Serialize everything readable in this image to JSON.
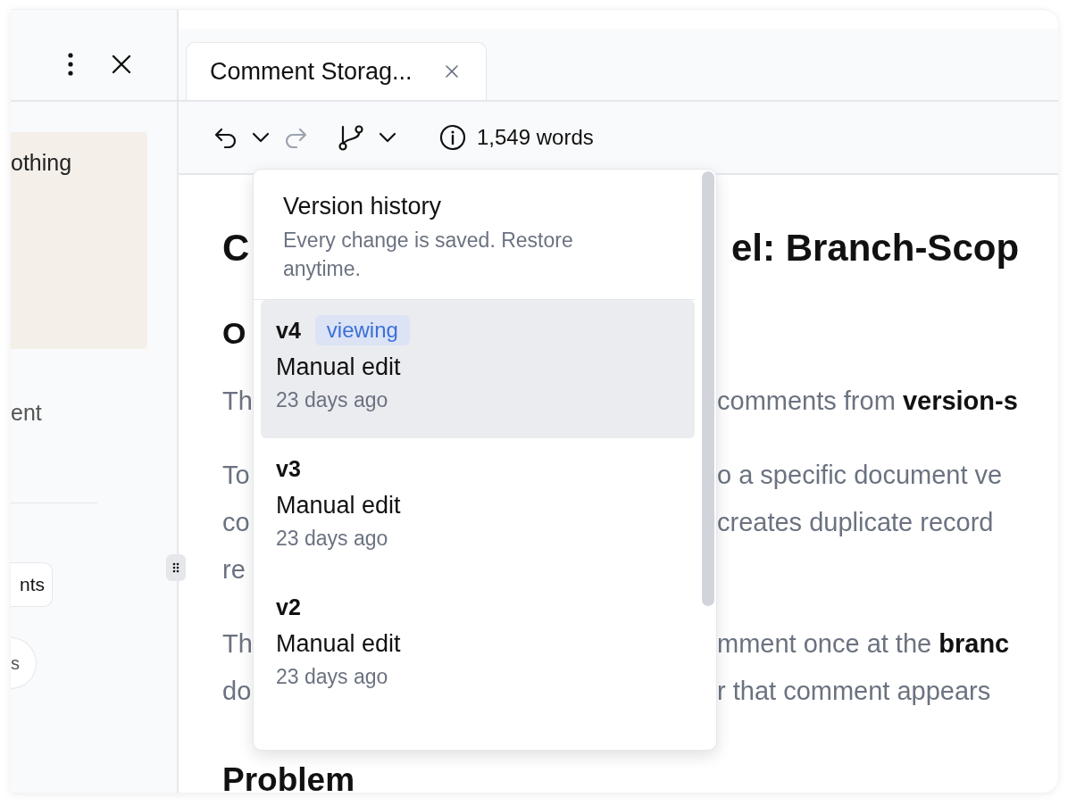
{
  "sidebar": {
    "card_text": "othing",
    "text": "ent",
    "buttons": [
      {
        "kind": "pill",
        "label": "nts"
      },
      {
        "kind": "round",
        "label": "s"
      }
    ]
  },
  "tabs": [
    {
      "label": "Comment Storag...",
      "selected": true
    }
  ],
  "toolbar": {
    "redo_disabled": true,
    "word_count": "1,549 words"
  },
  "document": {
    "title": {
      "left": "C",
      "right": "el: Branch-Scop"
    },
    "heading": "O",
    "paragraphs": [
      [
        {
          "left": "Th",
          "right": "comments from **version-s**"
        }
      ],
      [
        {
          "left": "To",
          "right": "o a specific document ve"
        },
        {
          "left": "co",
          "right": "creates duplicate record"
        },
        {
          "left": "re"
        }
      ],
      [
        {
          "left": "Th",
          "right": "mment once at the **branc**"
        },
        {
          "left": "do",
          "right": "r that comment appears"
        }
      ]
    ],
    "heading_2": "Problem"
  },
  "version_history": {
    "title": "Version history",
    "subtitle": "Every change is saved. Restore anytime.",
    "versions": [
      {
        "version": "v4",
        "badge": "viewing",
        "description": "Manual edit",
        "time": "23 days ago",
        "selected": true
      },
      {
        "version": "v3",
        "description": "Manual edit",
        "time": "23 days ago",
        "selected": false
      },
      {
        "version": "v2",
        "description": "Manual edit",
        "time": "23 days ago",
        "selected": false
      }
    ]
  }
}
